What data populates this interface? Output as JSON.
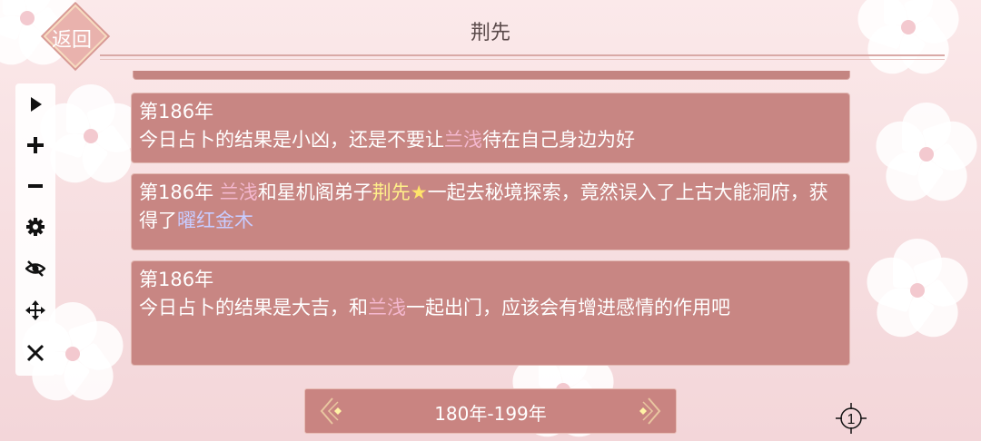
{
  "header": {
    "title": "荆先",
    "back_label": "返回"
  },
  "toolbar": {
    "tools": [
      {
        "icon": "play-icon"
      },
      {
        "icon": "plus-icon"
      },
      {
        "icon": "minus-icon"
      },
      {
        "icon": "gear-icon"
      },
      {
        "icon": "eye-off-icon"
      },
      {
        "icon": "move-icon"
      },
      {
        "icon": "close-icon"
      }
    ]
  },
  "entries": [
    {
      "year": "第186年",
      "text_a": "今日占卜的结果是小凶，还是不要让",
      "name": "兰浅",
      "text_b": "待在自己身边为好"
    },
    {
      "year": "第186年 ",
      "name": "兰浅",
      "text_a": "和星机阁弟子",
      "name2": "荆先",
      "star": "★",
      "text_b": "一起去秘境探索，竟然误入了上古大能洞府，获得了",
      "item": "曜红金木"
    },
    {
      "year": "第186年",
      "text_a": "今日占卜的结果是大吉，和",
      "name": "兰浅",
      "text_b": "一起出门，应该会有增进感情的作用吧"
    }
  ],
  "pager": {
    "label": "180年-199年"
  },
  "page_indicator": {
    "value": "1"
  },
  "colors": {
    "card_bg": "#c88683",
    "name_pink": "#f4b8cf",
    "name_yellow": "#fff08a",
    "item_blue": "#c8ccff"
  }
}
